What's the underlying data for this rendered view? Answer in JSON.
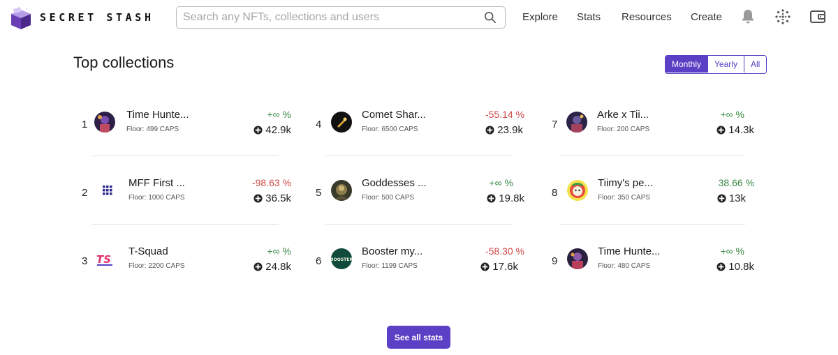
{
  "header": {
    "brand": "SECRET STASH",
    "search_placeholder": "Search any NFTs, collections and users",
    "nav": [
      "Explore",
      "Stats",
      "Resources",
      "Create"
    ],
    "icons": [
      "bell-icon",
      "theme-dots-icon",
      "wallet-icon"
    ]
  },
  "main": {
    "title": "Top collections",
    "tabs": [
      {
        "label": "Monthly",
        "active": true
      },
      {
        "label": "Yearly",
        "active": false
      },
      {
        "label": "All",
        "active": false
      }
    ],
    "see_all_label": "See all stats"
  },
  "collections": [
    {
      "rank": "1",
      "name": "Time Hunte...",
      "floor": "Floor: 499 CAPS",
      "change": "+∞ %",
      "change_type": "pos",
      "volume": "42.9k"
    },
    {
      "rank": "2",
      "name": "MFF First ...",
      "floor": "Floor: 1000 CAPS",
      "change": "-98.63 %",
      "change_type": "neg",
      "volume": "36.5k"
    },
    {
      "rank": "3",
      "name": "T-Squad",
      "floor": "Floor: 2200 CAPS",
      "change": "+∞ %",
      "change_type": "pos",
      "volume": "24.8k"
    },
    {
      "rank": "4",
      "name": "Comet Shar...",
      "floor": "Floor: 6500 CAPS",
      "change": "-55.14 %",
      "change_type": "neg",
      "volume": "23.9k"
    },
    {
      "rank": "5",
      "name": "Goddesses ...",
      "floor": "Floor: 500 CAPS",
      "change": "+∞ %",
      "change_type": "pos",
      "volume": "19.8k"
    },
    {
      "rank": "6",
      "name": "Booster my...",
      "floor": "Floor: 1199 CAPS",
      "change": "-58.30 %",
      "change_type": "neg",
      "volume": "17.6k"
    },
    {
      "rank": "7",
      "name": "Arke x Tii...",
      "floor": "Floor: 200 CAPS",
      "change": "+∞ %",
      "change_type": "pos",
      "volume": "14.3k"
    },
    {
      "rank": "8",
      "name": "Tiimy's pe...",
      "floor": "Floor: 350 CAPS",
      "change": "38.66 %",
      "change_type": "pos",
      "volume": "13k"
    },
    {
      "rank": "9",
      "name": "Time Hunte...",
      "floor": "Floor: 480 CAPS",
      "change": "+∞ %",
      "change_type": "pos",
      "volume": "10.8k"
    }
  ],
  "colors": {
    "accent": "#5b3fc4",
    "positive": "#3a8a44",
    "negative": "#d04848"
  }
}
